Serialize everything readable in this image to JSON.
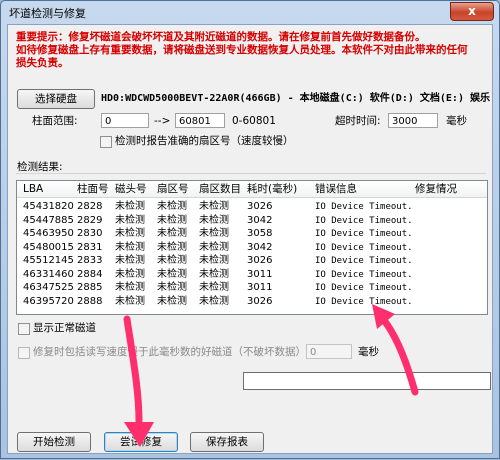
{
  "window": {
    "title": "坏道检测与修复",
    "close_glyph": "x"
  },
  "warning": {
    "line1": "重要提示：修复坏磁道会破坏坏道及其附近磁道的数据。请在修复前首先做好数据备份。",
    "line2": "如待修复磁盘上存有重要数据，请将磁盘送到专业数据恢复人员处理。本软件不对由此带来的任何",
    "line3": "损失负责。"
  },
  "disk": {
    "button_label": "选择硬盘",
    "selected": "HD0:WDCWD5000BEVT-22A0R(466GB) - 本地磁盘(C:) 软件(D:) 文档(E:) 娱乐"
  },
  "cylinder": {
    "label": "柱面范围:",
    "from": "0",
    "arrow": "-->",
    "to": "60801",
    "range": "0-60801"
  },
  "timeout": {
    "label": "超时时间:",
    "value": "3000",
    "unit": "毫秒"
  },
  "options": {
    "accurate_sector": "检测时报告准确的扇区号（速度较慢）",
    "show_normal": "显示正常磁道",
    "repair_slow": "修复时包括读写速度慢于此毫秒数的好磁道（不破坏数据）:",
    "repair_slow_value": "0",
    "repair_slow_unit": "毫秒"
  },
  "results": {
    "label": "检测结果:",
    "columns": [
      "LBA",
      "柱面号",
      "磁头号",
      "扇区号",
      "扇区数目",
      "耗时(毫秒)",
      "错误信息",
      "修复情况"
    ],
    "rows": [
      [
        "45431820",
        "2828",
        "未检测",
        "未检测",
        "未检测",
        "3026",
        "IO Device Timeout.",
        ""
      ],
      [
        "45447885",
        "2829",
        "未检测",
        "未检测",
        "未检测",
        "3042",
        "IO Device Timeout.",
        ""
      ],
      [
        "45463950",
        "2830",
        "未检测",
        "未检测",
        "未检测",
        "3058",
        "IO Device Timeout.",
        ""
      ],
      [
        "45480015",
        "2831",
        "未检测",
        "未检测",
        "未检测",
        "3042",
        "IO Device Timeout.",
        ""
      ],
      [
        "45512145",
        "2833",
        "未检测",
        "未检测",
        "未检测",
        "3026",
        "IO Device Timeout.",
        ""
      ],
      [
        "46331460",
        "2884",
        "未检测",
        "未检测",
        "未检测",
        "3011",
        "IO Device Timeout.",
        ""
      ],
      [
        "46347525",
        "2885",
        "未检测",
        "未检测",
        "未检测",
        "3011",
        "IO Device Timeout.",
        ""
      ],
      [
        "46395720",
        "2888",
        "未检测",
        "未检测",
        "未检测",
        "3026",
        "IO Device Timeout.",
        ""
      ]
    ]
  },
  "buttons": {
    "start": "开始检测",
    "repair": "尝试修复",
    "save": "保存报表"
  },
  "colors": {
    "warning": "#d60000",
    "arrow": "#ff2f6e"
  }
}
